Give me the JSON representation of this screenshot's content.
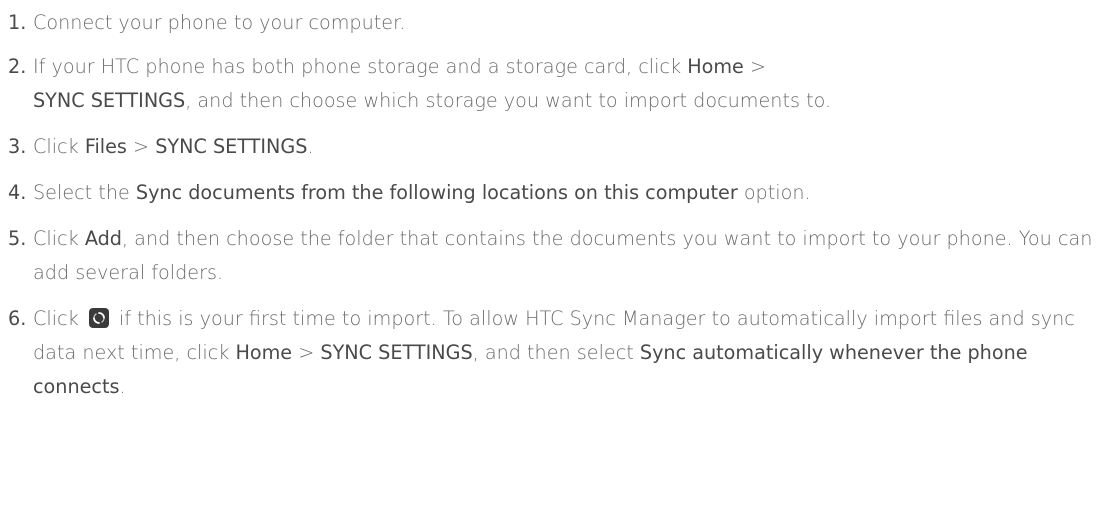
{
  "steps": [
    {
      "number": "1.",
      "parts": [
        {
          "t": "Connect your phone to your computer.",
          "em": false
        }
      ]
    },
    {
      "number": "2.",
      "parts": [
        {
          "t": "If your HTC phone has both phone storage and a storage card, click ",
          "em": false
        },
        {
          "t": "Home",
          "em": true
        },
        {
          "t": " >",
          "em": false
        },
        {
          "t": "SYNC SETTINGS",
          "em": true
        },
        {
          "t": ", and then choose which storage you want to import documents to.",
          "em": false
        }
      ]
    },
    {
      "number": "3.",
      "parts": [
        {
          "t": "Click ",
          "em": false
        },
        {
          "t": "Files",
          "em": true
        },
        {
          "t": " > ",
          "em": false
        },
        {
          "t": "SYNC SETTINGS",
          "em": true
        },
        {
          "t": ".",
          "em": false
        }
      ]
    },
    {
      "number": "4.",
      "parts": [
        {
          "t": "Select the ",
          "em": false
        },
        {
          "t": "Sync documents from the following locations on this computer",
          "em": true
        },
        {
          "t": " option.",
          "em": false
        }
      ]
    },
    {
      "number": "5.",
      "parts": [
        {
          "t": "Click ",
          "em": false
        },
        {
          "t": "Add",
          "em": true
        },
        {
          "t": ", and then choose the folder that contains the documents you want to import to your phone. You can add several folders.",
          "em": false
        }
      ]
    },
    {
      "number": "6.",
      "parts": [
        {
          "t": "Click ",
          "em": false
        },
        {
          "icon": "sync-icon"
        },
        {
          "t": " if this is your first time to import. To allow HTC Sync Manager to automatically import files and sync data next time, click ",
          "em": false
        },
        {
          "t": "Home",
          "em": true
        },
        {
          "t": " > ",
          "em": false
        },
        {
          "t": "SYNC SETTINGS",
          "em": true
        },
        {
          "t": ", and then select ",
          "em": false
        },
        {
          "t": "Sync automatically whenever the phone connects",
          "em": true
        },
        {
          "t": ".",
          "em": false
        }
      ]
    }
  ]
}
